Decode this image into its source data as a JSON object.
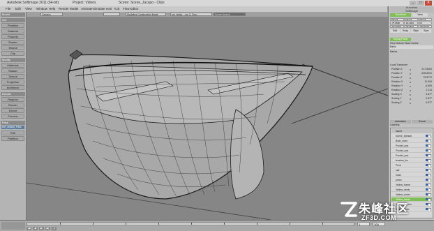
{
  "window": {
    "title": "Autodesk Softimage 2011 (64-bit)",
    "project": "Project: Videos",
    "scene": "Scene: Scene_Jacapo - Clips",
    "buttons": {
      "minimize": "_",
      "maximize": "□",
      "close": "✕"
    }
  },
  "menubar": {
    "items": [
      "File",
      "Edit",
      "View",
      "Window",
      "Help",
      "Render",
      "Model",
      "Animate",
      "Simulate",
      "Hair",
      "ICE",
      "Flow Editor"
    ]
  },
  "toolbar": {
    "camera": "Camera",
    "construction": "Modeling Construction Mode",
    "object": "sm_siglat_...sa_5_Dan...",
    "search": "Scene Search"
  },
  "left_panel": {
    "mode": "Model",
    "sections": [
      {
        "header": "Get",
        "buttons": [
          "Primitive",
          "Material",
          "Property",
          "Shader",
          "Texture",
          "Clip"
        ]
      },
      {
        "header": "Modify",
        "buttons": [
          "Materials",
          "Shader",
          "Texture",
          "Projection",
          "Ambience"
        ]
      },
      {
        "header": "Render",
        "buttons": [
          "Regions",
          "Render",
          "Export",
          "Preview"
        ]
      },
      {
        "header": "Pass",
        "buttons": [
          "Edit",
          "Partition"
        ]
      }
    ],
    "pass_selector": "Def_default_Pass"
  },
  "right_panel": {
    "logo_line1": "Autodesk",
    "logo_line2": "Softimage",
    "tabs": [
      "Transform",
      "View"
    ],
    "fields": [
      "0.8774",
      "0.8774",
      "0.8774",
      "-75.6638",
      "-19.1324",
      "0.0",
      "-107.2405",
      "-30.3874",
      "-376.2733"
    ],
    "edit_tools": [
      "Edit",
      "Snap",
      "Style",
      "Sync"
    ],
    "keying_panel": "Keying Panel",
    "keyable_row": "Keys  Subset  Stack  Nodes",
    "basic_label": "Basic",
    "section_basics": "Basics",
    "section_transform": "Local Transform",
    "rows": [
      {
        "label": "Position X",
        "value": "217.8262"
      },
      {
        "label": "Position Y",
        "value": "-205.5931"
      },
      {
        "label": "Position Z",
        "value": "79.8772"
      },
      {
        "label": "Rotation X",
        "value": "11.694"
      },
      {
        "label": "Rotation Y",
        "value": "-6.609"
      },
      {
        "label": "Rotation Z",
        "value": "2.114"
      },
      {
        "label": "Scaling X",
        "value": "0.877"
      },
      {
        "label": "Scaling Y",
        "value": "0.877"
      },
      {
        "label": "Scaling Z",
        "value": "0.877"
      }
    ],
    "explorer_tabs": [
      "Animation",
      "Scene"
    ],
    "explorer_filter": "Layering",
    "outliner_header": "Name",
    "outliner_rows": [
      "Scene_Default",
      "Boat_main",
      "Pocket_pos",
      "Pocket_pos",
      "Pocket_pos",
      "teraries_inc",
      "Pivot",
      "sail",
      "mast",
      "pimm",
      "Yellow_frame",
      "Yellow_vents",
      "Yellow_mmm",
      "Yellow_frame",
      "Yellow_bottom",
      "Yellow_timer"
    ],
    "outliner_selected_index": 13,
    "outliner_columns": [
      "Mi",
      "Vis",
      "Sel"
    ]
  },
  "timeline": {
    "start": "1",
    "end": "100",
    "current": "1",
    "tick_labels": [
      "10",
      "20",
      "30",
      "40",
      "50",
      "60",
      "70",
      "80",
      "90",
      "100"
    ],
    "controls": [
      "|◀",
      "◀",
      "▶",
      "▶|",
      "●"
    ]
  },
  "watermark": {
    "chinese": "朱峰社区",
    "latin": "ZF3D.COM"
  },
  "colors": {
    "viewport_bg": "#868686",
    "wireframe": "#1c1c1c",
    "boat_shade": "#a6a6a6",
    "accent_green": "#7fbf55",
    "selected_blue": "#5d7c9b"
  }
}
